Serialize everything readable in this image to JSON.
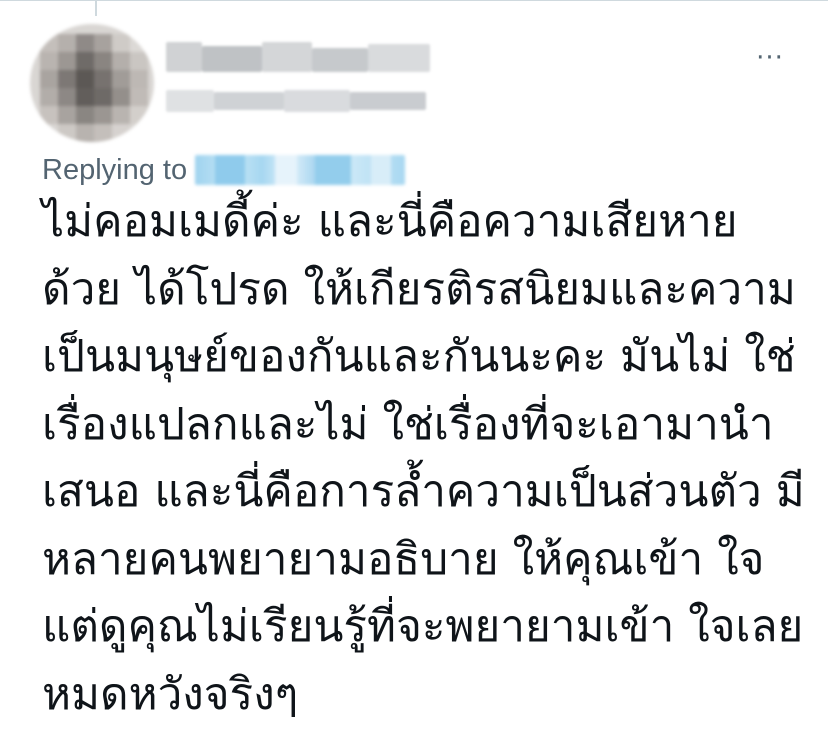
{
  "tweet": {
    "replying_prefix": "Replying to",
    "more_icon": "more-horizontal-icon",
    "lines": [
      "ไม่คอมเมดี้ค่ะ และนี่คือความเสียหาย",
      "ด้วย ได้โปรด ให้เกียรติรสนิยมและความ",
      "เป็นมนุษย์ของกันและกันนะคะ มันไม่ ใช่",
      "เรื่องแปลกและไม่ ใช่เรื่องที่จะเอามานำ",
      "เสนอ และนี่คือการล้ำความเป็นส่วนตัว มี",
      "หลายคนพยายามอธิบาย ให้คุณเข้า ใจ",
      "แต่ดูคุณไม่เรียนรู้ที่จะพยายามเข้า ใจเลย",
      "หมดหวังจริงๆ"
    ]
  },
  "colors": {
    "text": "#0f1419",
    "secondary": "#536471",
    "link_blur": "#1d9bf0",
    "border": "#cfd9de"
  }
}
